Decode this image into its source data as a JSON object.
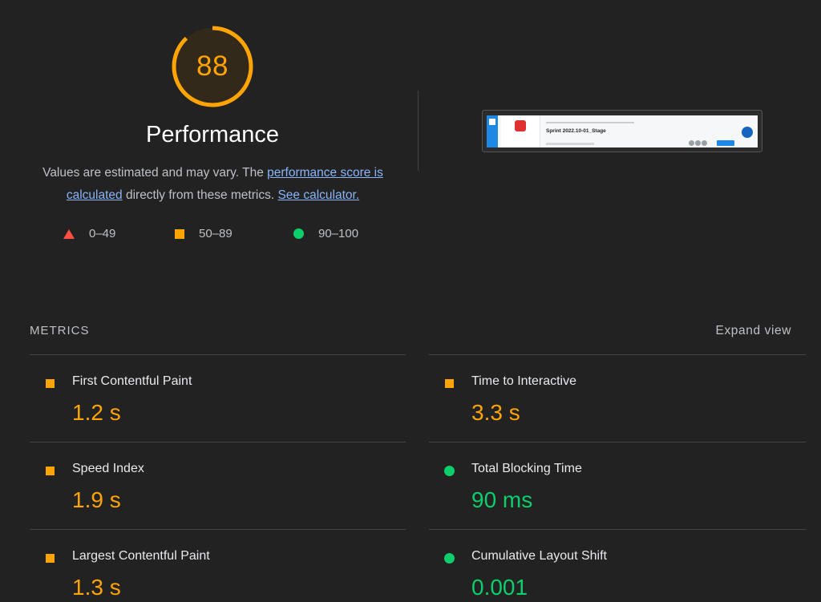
{
  "score": {
    "value": "88",
    "fraction": 0.88,
    "color": "#ffa400"
  },
  "category_title": "Performance",
  "description": {
    "prefix": "Values are estimated and may vary. The ",
    "link1": "performance score is calculated",
    "middle": " directly from these metrics. ",
    "link2": "See calculator."
  },
  "legend": [
    {
      "shape": "triangle-icon",
      "range": "0–49",
      "color": "#ff4e42"
    },
    {
      "shape": "square-icon",
      "range": "50–89",
      "color": "#ffa400"
    },
    {
      "shape": "circle-icon",
      "range": "90–100",
      "color": "#0cce6b"
    }
  ],
  "thumbnail": {
    "title": "Sprint 2022.10-01_Stage"
  },
  "metrics_section": {
    "header": "METRICS",
    "expand": "Expand view"
  },
  "metrics": [
    {
      "label": "First Contentful Paint",
      "value": "1.2 s",
      "rating": "average",
      "icon": "square-icon"
    },
    {
      "label": "Time to Interactive",
      "value": "3.3 s",
      "rating": "average",
      "icon": "square-icon"
    },
    {
      "label": "Speed Index",
      "value": "1.9 s",
      "rating": "average",
      "icon": "square-icon"
    },
    {
      "label": "Total Blocking Time",
      "value": "90 ms",
      "rating": "pass",
      "icon": "circle-icon"
    },
    {
      "label": "Largest Contentful Paint",
      "value": "1.3 s",
      "rating": "average",
      "icon": "square-icon"
    },
    {
      "label": "Cumulative Layout Shift",
      "value": "0.001",
      "rating": "pass",
      "icon": "circle-icon"
    }
  ]
}
